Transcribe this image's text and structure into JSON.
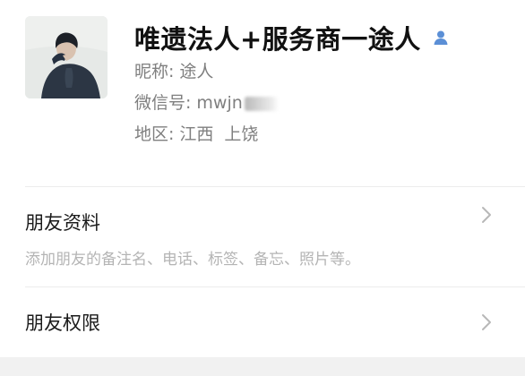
{
  "profile": {
    "display_name": "唯遗法人+服务商一途人",
    "name_icon": "person-icon",
    "nickname_label": "昵称:",
    "nickname_value": "途人",
    "wechat_id_label": "微信号:",
    "wechat_id_value": "mwjn",
    "region_label": "地区:",
    "region_province": "江西",
    "region_city": "上饶"
  },
  "menu": {
    "friend_info": {
      "title": "朋友资料",
      "description": "添加朋友的备注名、电话、标签、备忘、照片等。"
    },
    "friend_permissions": {
      "title": "朋友权限"
    }
  },
  "colors": {
    "secondary_text": "#7f7f7f",
    "hint_text": "#b4b4b4",
    "accent_icon": "#5b8fd6"
  }
}
